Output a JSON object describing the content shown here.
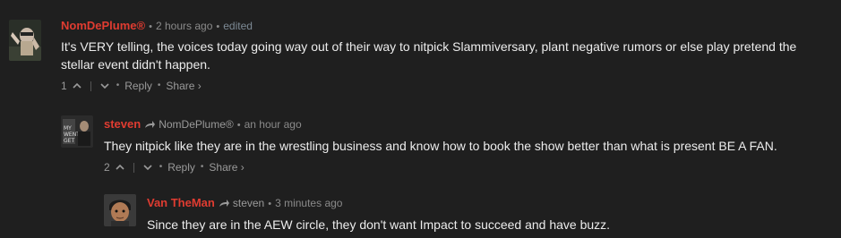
{
  "comments": [
    {
      "author": "NomDePlume",
      "author_badge": "®",
      "time": "2 hours ago",
      "edited": "edited",
      "text": "It's VERY telling, the voices today going way out of their way to nitpick Slammiversary, plant negative rumors or else play pretend the stellar event didn't happen.",
      "votes": "1",
      "reply_label": "Reply",
      "share_label": "Share ›"
    },
    {
      "author": "steven",
      "reply_to": "NomDePlume®",
      "time": "an hour ago",
      "text": "They nitpick like they are in the wrestling business and know how to book the show better than what is present BE A FAN.",
      "votes": "2",
      "reply_label": "Reply",
      "share_label": "Share ›"
    },
    {
      "author": "Van TheMan",
      "reply_to": "steven",
      "time": "3 minutes ago",
      "text": "Since they are in the AEW circle, they don't want Impact to succeed and have buzz."
    }
  ],
  "colors": {
    "background": "#1f1f1f",
    "author": "#e03c31",
    "meta": "#8a8a8a",
    "text": "#ececec"
  }
}
